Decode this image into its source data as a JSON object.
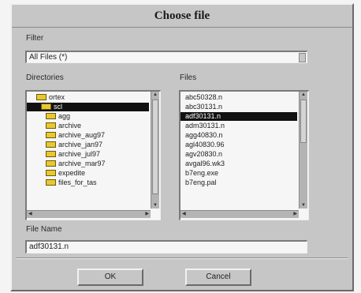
{
  "dialog": {
    "title": "Choose file"
  },
  "filter": {
    "label": "Filter",
    "value": "All Files (*)"
  },
  "directories": {
    "label": "Directories",
    "items": [
      {
        "name": "ortex",
        "indent": 1
      },
      {
        "name": "scl",
        "indent": 2,
        "selected": true
      },
      {
        "name": "agg",
        "indent": 3
      },
      {
        "name": "archive",
        "indent": 3
      },
      {
        "name": "archive_aug97",
        "indent": 3
      },
      {
        "name": "archive_jan97",
        "indent": 3
      },
      {
        "name": "archive_jul97",
        "indent": 3
      },
      {
        "name": "archive_mar97",
        "indent": 3
      },
      {
        "name": "expedite",
        "indent": 3
      },
      {
        "name": "files_for_tas",
        "indent": 3
      }
    ]
  },
  "files": {
    "label": "Files",
    "items": [
      "abc50328.n",
      "abc30131.n",
      "adf30131.n",
      "adm30131.n",
      "agg40830.n",
      "agl40830.96",
      "agv20830.n",
      "avgal96.wk3",
      "b7eng.exe",
      "b7eng.pal"
    ],
    "selected_index": 2
  },
  "filename": {
    "label": "File Name",
    "value": "adf30131.n"
  },
  "buttons": {
    "ok": "OK",
    "cancel": "Cancel"
  },
  "icons": {
    "folder": "folder-icon",
    "dropdown": "dropdown-arrow-icon"
  }
}
